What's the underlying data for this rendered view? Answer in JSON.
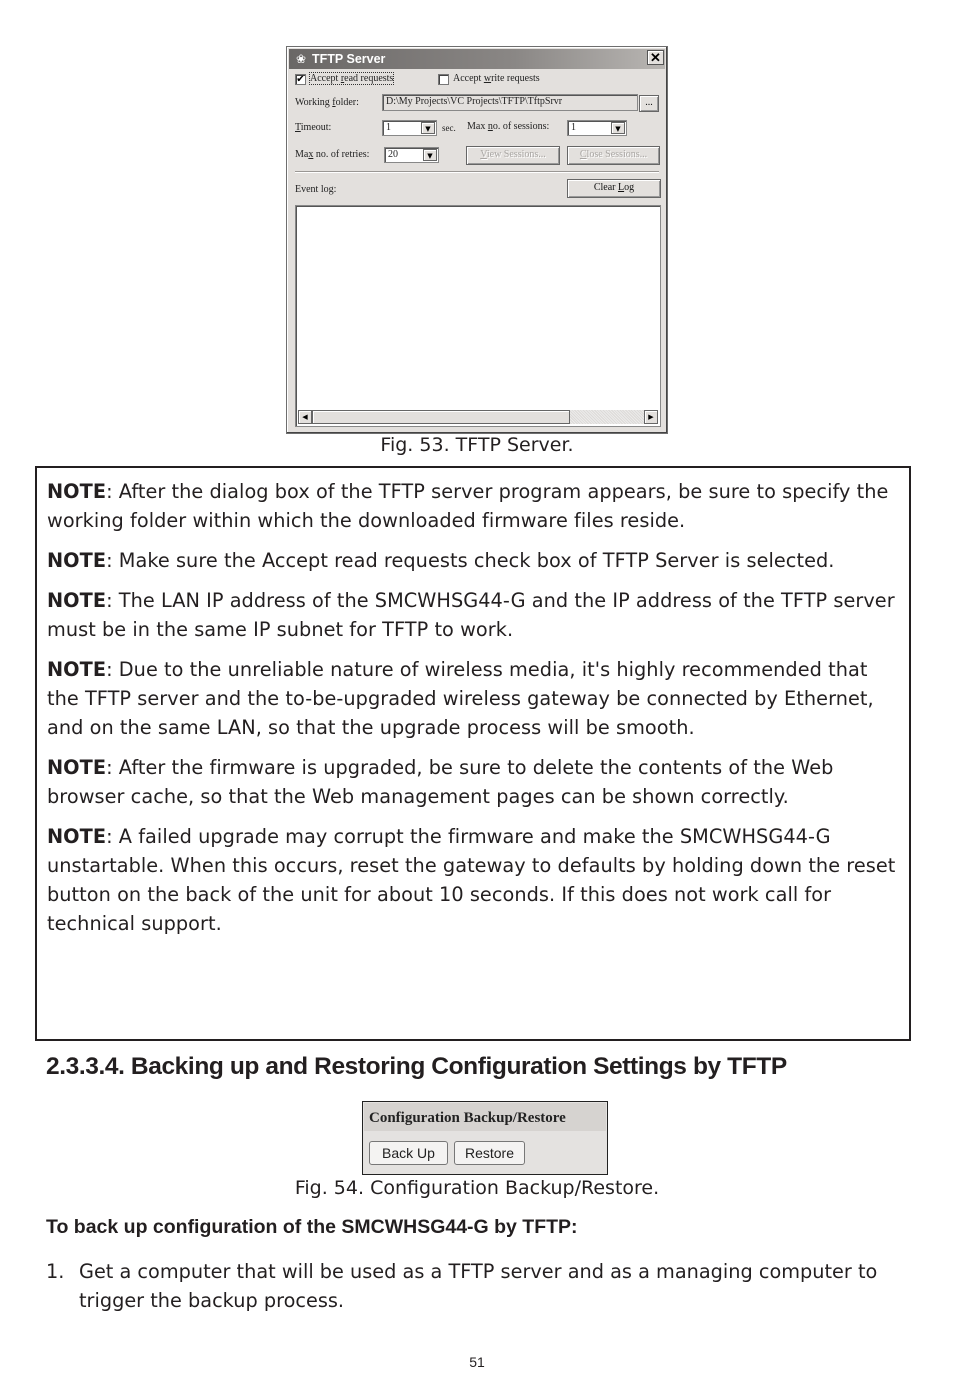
{
  "figure53": {
    "dialog": {
      "title": "TFTP Server",
      "close_glyph": "✕",
      "app_icon": "tftp-app-icon",
      "accept_read": {
        "label_pre": "Accept ",
        "label_u": "r",
        "label_post": "ead requests",
        "checked": true,
        "check_glyph": "✔"
      },
      "accept_write": {
        "label_pre": "Accept ",
        "label_u": "w",
        "label_post": "rite requests",
        "checked": false,
        "check_glyph": ""
      },
      "working_folder": {
        "label_pre": "Working ",
        "label_u": "f",
        "label_post": "older:",
        "value": "D:\\My Projects\\VC Projects\\TFTP\\TftpSrvr",
        "browse_label": "..."
      },
      "timeout": {
        "label_u": "T",
        "label_post": "imeout:",
        "value": "1",
        "unit": "sec."
      },
      "max_sessions": {
        "label_pre": "Max ",
        "label_u": "n",
        "label_post": "o. of sessions:",
        "value": "1"
      },
      "max_retries": {
        "label_pre": "Ma",
        "label_u": "x",
        "label_post": " no. of retries:",
        "value": "20"
      },
      "view_sessions": {
        "label_u": "V",
        "label_post": "iew Sessions..."
      },
      "close_sessions": {
        "label_u": "C",
        "label_post": "lose Sessions..."
      },
      "event_log_label": "Event log:",
      "clear_log": {
        "label_pre": "Clear ",
        "label_u": "L",
        "label_post": "og"
      },
      "dropdown_glyph": "▼",
      "scroll_left_glyph": "◀",
      "scroll_right_glyph": "▶"
    },
    "caption": "Fig. 53. TFTP Server."
  },
  "notes": [
    {
      "label": "NOTE",
      "text": ": After the dialog box of the TFTP server program appears, be sure to specify the working folder within which the downloaded firmware files reside."
    },
    {
      "label": "NOTE",
      "text": ": Make sure the Accept read requests check box of TFTP Server is selected."
    },
    {
      "label": "NOTE",
      "text": ": The LAN IP address of the SMCWHSG44-G and the IP address of the TFTP server must be in the same IP subnet for TFTP to work."
    },
    {
      "label": "NOTE",
      "text": ": Due to the unreliable nature of wireless media, it's highly recommended that the TFTP server and the to-be-upgraded wireless gateway be connected by Ethernet, and on the same LAN, so that the upgrade process will be smooth."
    },
    {
      "label": "NOTE",
      "text": ": After the firmware is upgraded, be sure to delete the contents of the Web browser cache, so that the Web management pages can be shown correctly."
    },
    {
      "label": "NOTE",
      "text": ": A failed upgrade may corrupt the firmware and make the SMCWHSG44-G unstartable. When this occurs, reset the gateway to defaults by holding down the reset button on the back of the unit for about 10 seconds. If this does not work call for technical support."
    }
  ],
  "section": {
    "heading": "2.3.3.4. Backing up and Restoring Configuration Settings by TFTP"
  },
  "figure54": {
    "panel_title": "Configuration Backup/Restore",
    "backup_button": "Back Up",
    "restore_button": "Restore",
    "caption": "Fig. 54. Configuration Backup/Restore."
  },
  "procedure": {
    "heading": "To back up configuration of the SMCWHSG44-G by TFTP:",
    "steps": [
      {
        "number": "1.",
        "text": "Get a computer that will be used as a TFTP server and as a managing computer to trigger the backup process."
      }
    ]
  },
  "page_number": "51"
}
